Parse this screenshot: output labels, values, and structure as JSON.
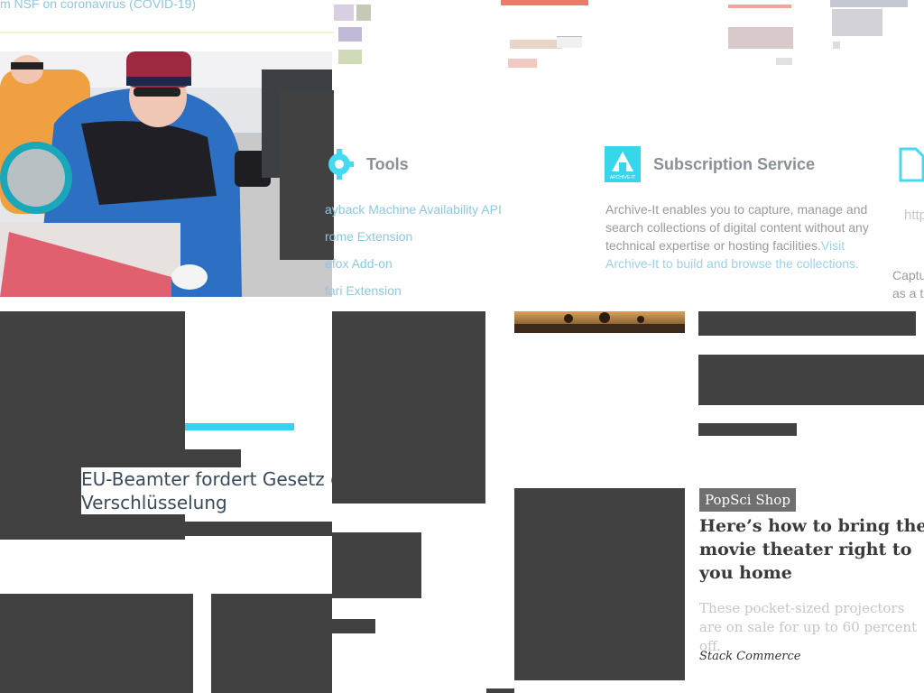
{
  "top_banner": {
    "text": "m NSF on coronavirus (COVID-19)"
  },
  "tools": {
    "heading": "Tools",
    "links": [
      "ayback Machine Availability API",
      "rome Extension",
      "efox Add-on",
      "fari Extension"
    ]
  },
  "subscription": {
    "heading": "Subscription Service",
    "body": "Archive-It enables you to capture, manage and search collections of digital content without any technical expertise or hosting facilities.",
    "link_text": "Visit Archive-It to build and browse the collections.",
    "icon_label": "ARCHIVE-IT"
  },
  "right_column": {
    "url_fragment": "http",
    "caption_1": "Captu",
    "caption_2": "as a t"
  },
  "news": {
    "headline_line1": "EU-Beamter fordert Gesetz geg",
    "headline_line2": "Verschlüsselung"
  },
  "popsci": {
    "tag": "PopSci Shop",
    "headline": "Here’s how to bring the movie theater right to you home",
    "dek": "These pocket-sized projectors are on sale for up to 60 percent off.",
    "byline": "Stack Commerce"
  },
  "colors": {
    "accent_cyan": "#35d4ec",
    "dark_block": "#414141",
    "link_blue": "#5fb4d8"
  }
}
